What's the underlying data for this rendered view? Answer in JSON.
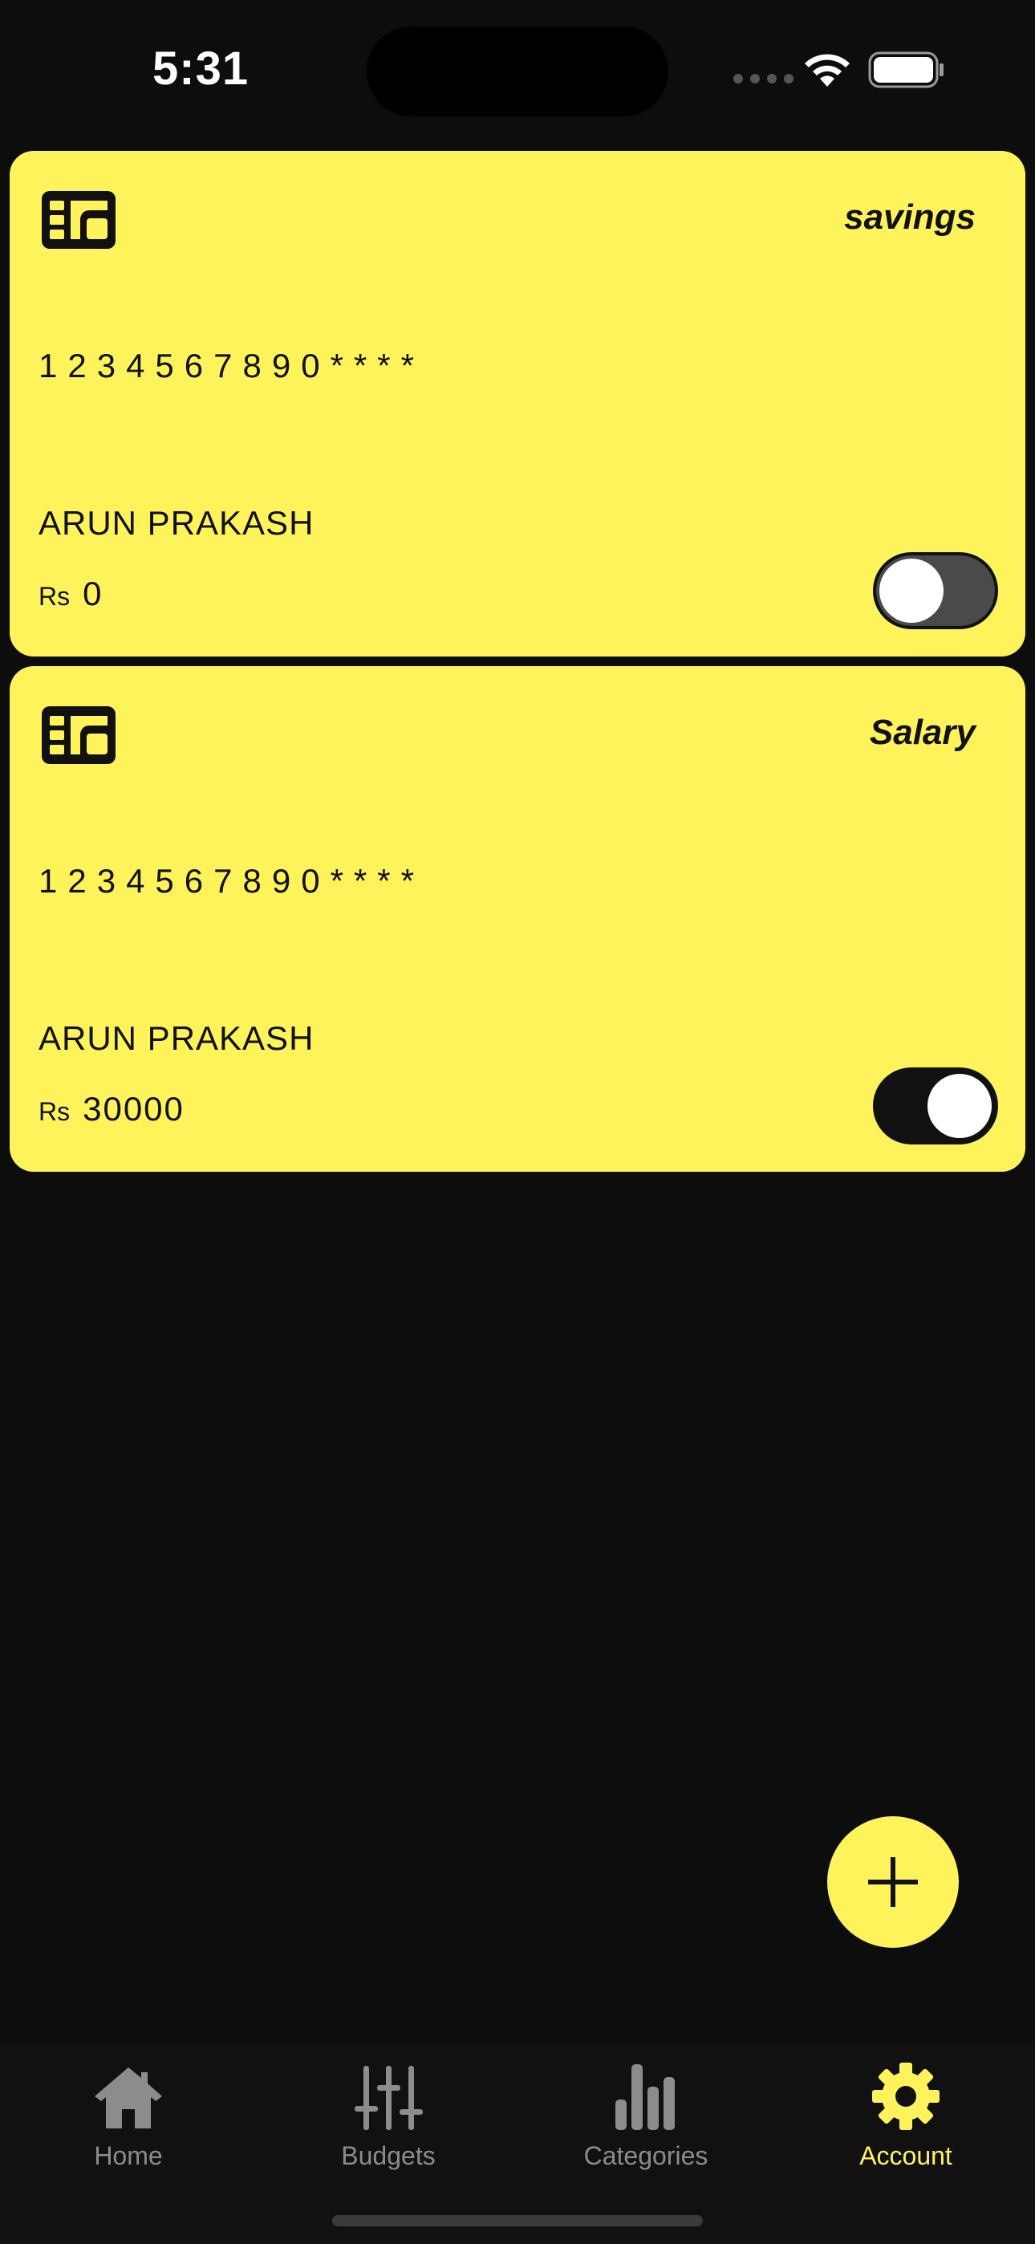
{
  "status_bar": {
    "time": "5:31"
  },
  "cards": [
    {
      "type": "savings",
      "number": "1234567890****",
      "holder": "ARUN PRAKASH",
      "currency": "Rs",
      "amount": "0",
      "toggle_on": false
    },
    {
      "type": "Salary",
      "number": "1234567890****",
      "holder": "ARUN PRAKASH",
      "currency": "Rs",
      "amount": "30000",
      "toggle_on": true
    }
  ],
  "fab": {
    "icon": "plus-icon"
  },
  "bottom_nav": {
    "items": [
      {
        "label": "Home",
        "icon": "home-icon",
        "active": false
      },
      {
        "label": "Budgets",
        "icon": "sliders-icon",
        "active": false
      },
      {
        "label": "Categories",
        "icon": "bar-chart-icon",
        "active": false
      },
      {
        "label": "Account",
        "icon": "gear-icon",
        "active": true
      }
    ]
  },
  "colors": {
    "background": "#0d0d0d",
    "card": "#fff35c",
    "accent": "#fff35c",
    "nav_inactive": "#8c8c8c"
  }
}
